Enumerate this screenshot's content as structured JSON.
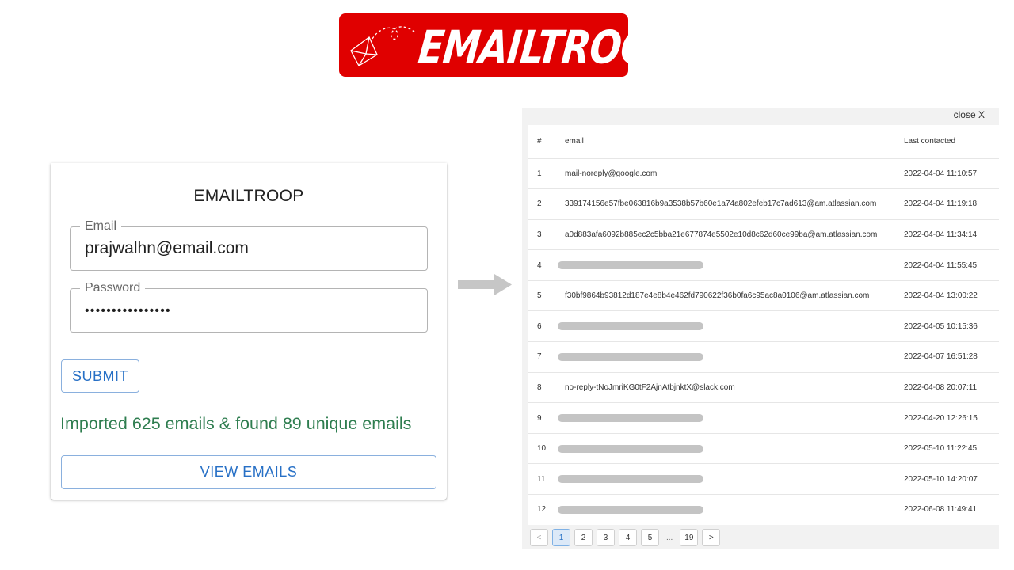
{
  "logo": {
    "text": "EMAILTROOP",
    "brand_color": "#e00000",
    "icon": "envelope-plane-icon"
  },
  "login": {
    "title": "EMAILTROOP",
    "email_label": "Email",
    "email_value": "prajwalhn@email.com",
    "password_label": "Password",
    "password_value": "••••••••••••••••",
    "submit_label": "SUBMIT",
    "status_text": "Imported 625 emails & found 89 unique emails",
    "view_label": "VIEW EMAILS",
    "accent_color": "#2770c6",
    "status_color": "#2e7d4f"
  },
  "arrow": {
    "icon": "right-arrow-icon"
  },
  "emails_panel": {
    "close_label": "close X",
    "columns": [
      "#",
      "email",
      "Last contacted"
    ],
    "rows": [
      {
        "num": "1",
        "email": "mail-noreply@google.com",
        "date": "2022-04-04 11:10:57",
        "redacted": false
      },
      {
        "num": "2",
        "email": "339174156e57fbe063816b9a3538b57b60e1a74a802efeb17c7ad613@am.atlassian.com",
        "date": "2022-04-04 11:19:18",
        "redacted": false
      },
      {
        "num": "3",
        "email": "a0d883afa6092b885ec2c5bba21e677874e5502e10d8c62d60ce99ba@am.atlassian.com",
        "date": "2022-04-04 11:34:14",
        "redacted": false
      },
      {
        "num": "4",
        "email": "",
        "date": "2022-04-04 11:55:45",
        "redacted": true
      },
      {
        "num": "5",
        "email": "f30bf9864b93812d187e4e8b4e462fd790622f36b0fa6c95ac8a0106@am.atlassian.com",
        "date": "2022-04-04 13:00:22",
        "redacted": false
      },
      {
        "num": "6",
        "email": "",
        "date": "2022-04-05 10:15:36",
        "redacted": true
      },
      {
        "num": "7",
        "email": "",
        "date": "2022-04-07 16:51:28",
        "redacted": true
      },
      {
        "num": "8",
        "email": "no-reply-tNoJmriKG0tF2AjnAtbjnktX@slack.com",
        "date": "2022-04-08 20:07:11",
        "redacted": false
      },
      {
        "num": "9",
        "email": "",
        "date": "2022-04-20 12:26:15",
        "redacted": true
      },
      {
        "num": "10",
        "email": "",
        "date": "2022-05-10 11:22:45",
        "redacted": true
      },
      {
        "num": "11",
        "email": "",
        "date": "2022-05-10 14:20:07",
        "redacted": true
      },
      {
        "num": "12",
        "email": "",
        "date": "2022-06-08 11:49:41",
        "redacted": true
      }
    ],
    "pagination": {
      "prev": "<",
      "pages": [
        "1",
        "2",
        "3",
        "4",
        "5"
      ],
      "ellipsis": "...",
      "last": "19",
      "next": ">",
      "current": "1"
    }
  }
}
